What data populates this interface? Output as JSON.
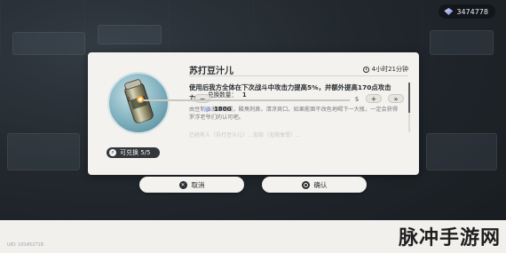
{
  "currency": {
    "icon": "gem-icon",
    "amount": "3474778"
  },
  "dialog": {
    "item_name": "苏打豆汁儿",
    "timer": "4小时21分钟",
    "description": "使用后我方全体在下次战斗中攻击力提高5%，并额外提高170点攻击力。",
    "flavor_text": "由豆制品发酵而成，酸臭刺鼻，清凉爽口。如果能面不改色地喝下一大瓶，一定会获得罗浮老爷们的认可吧。",
    "faded_text": "已经有人（苏打豆汁儿）…加倍（无限享受）…",
    "redeem_badge": "可兑换 5/5",
    "quantity_label": "兑换数量：",
    "quantity_value": "1",
    "range_min": "1",
    "range_max": "5",
    "slider_fraction": 0.0,
    "cost": "1800",
    "minus_label": "−",
    "plus_label": "+",
    "max_label": "»"
  },
  "actions": {
    "cancel_label": "取消",
    "confirm_label": "确认"
  },
  "uid": "UID: 101452718",
  "watermark": "脉冲手游网",
  "colors": {
    "accent": "#f0a53b",
    "panel": "#f3f2ee",
    "dark": "#2a2d31"
  }
}
